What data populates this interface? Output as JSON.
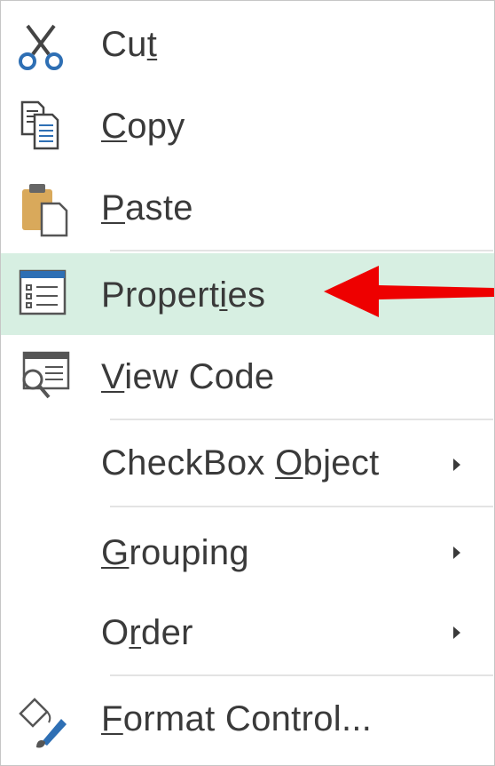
{
  "menu": {
    "items": [
      {
        "id": "cut",
        "pre": "Cu",
        "ul": "t",
        "post": "",
        "icon": "scissors-icon"
      },
      {
        "id": "copy",
        "pre": "",
        "ul": "C",
        "post": "opy",
        "icon": "copy-icon"
      },
      {
        "id": "paste",
        "pre": "",
        "ul": "P",
        "post": "aste",
        "icon": "paste-clipboard-icon"
      },
      {
        "id": "properties",
        "pre": "Propert",
        "ul": "i",
        "post": "es",
        "icon": "properties-icon",
        "highlighted": true
      },
      {
        "id": "view_code",
        "pre": "",
        "ul": "V",
        "post": "iew Code",
        "icon": "view-code-icon"
      },
      {
        "id": "checkbox_object",
        "pre": "CheckBox ",
        "ul": "O",
        "post": "bject",
        "submenu": true
      },
      {
        "id": "grouping",
        "pre": "",
        "ul": "G",
        "post": "rouping",
        "submenu": true
      },
      {
        "id": "order",
        "pre": "O",
        "ul": "r",
        "post": "der",
        "submenu": true
      },
      {
        "id": "format_control",
        "pre": "",
        "ul": "F",
        "post": "ormat Control...",
        "icon": "format-control-icon"
      }
    ]
  },
  "colors": {
    "highlight": "#d7efe2",
    "text": "#3a3a3a",
    "separator": "#e3e3e3",
    "annotation_arrow": "#ee0000",
    "icon_blue": "#2e6fb4"
  }
}
